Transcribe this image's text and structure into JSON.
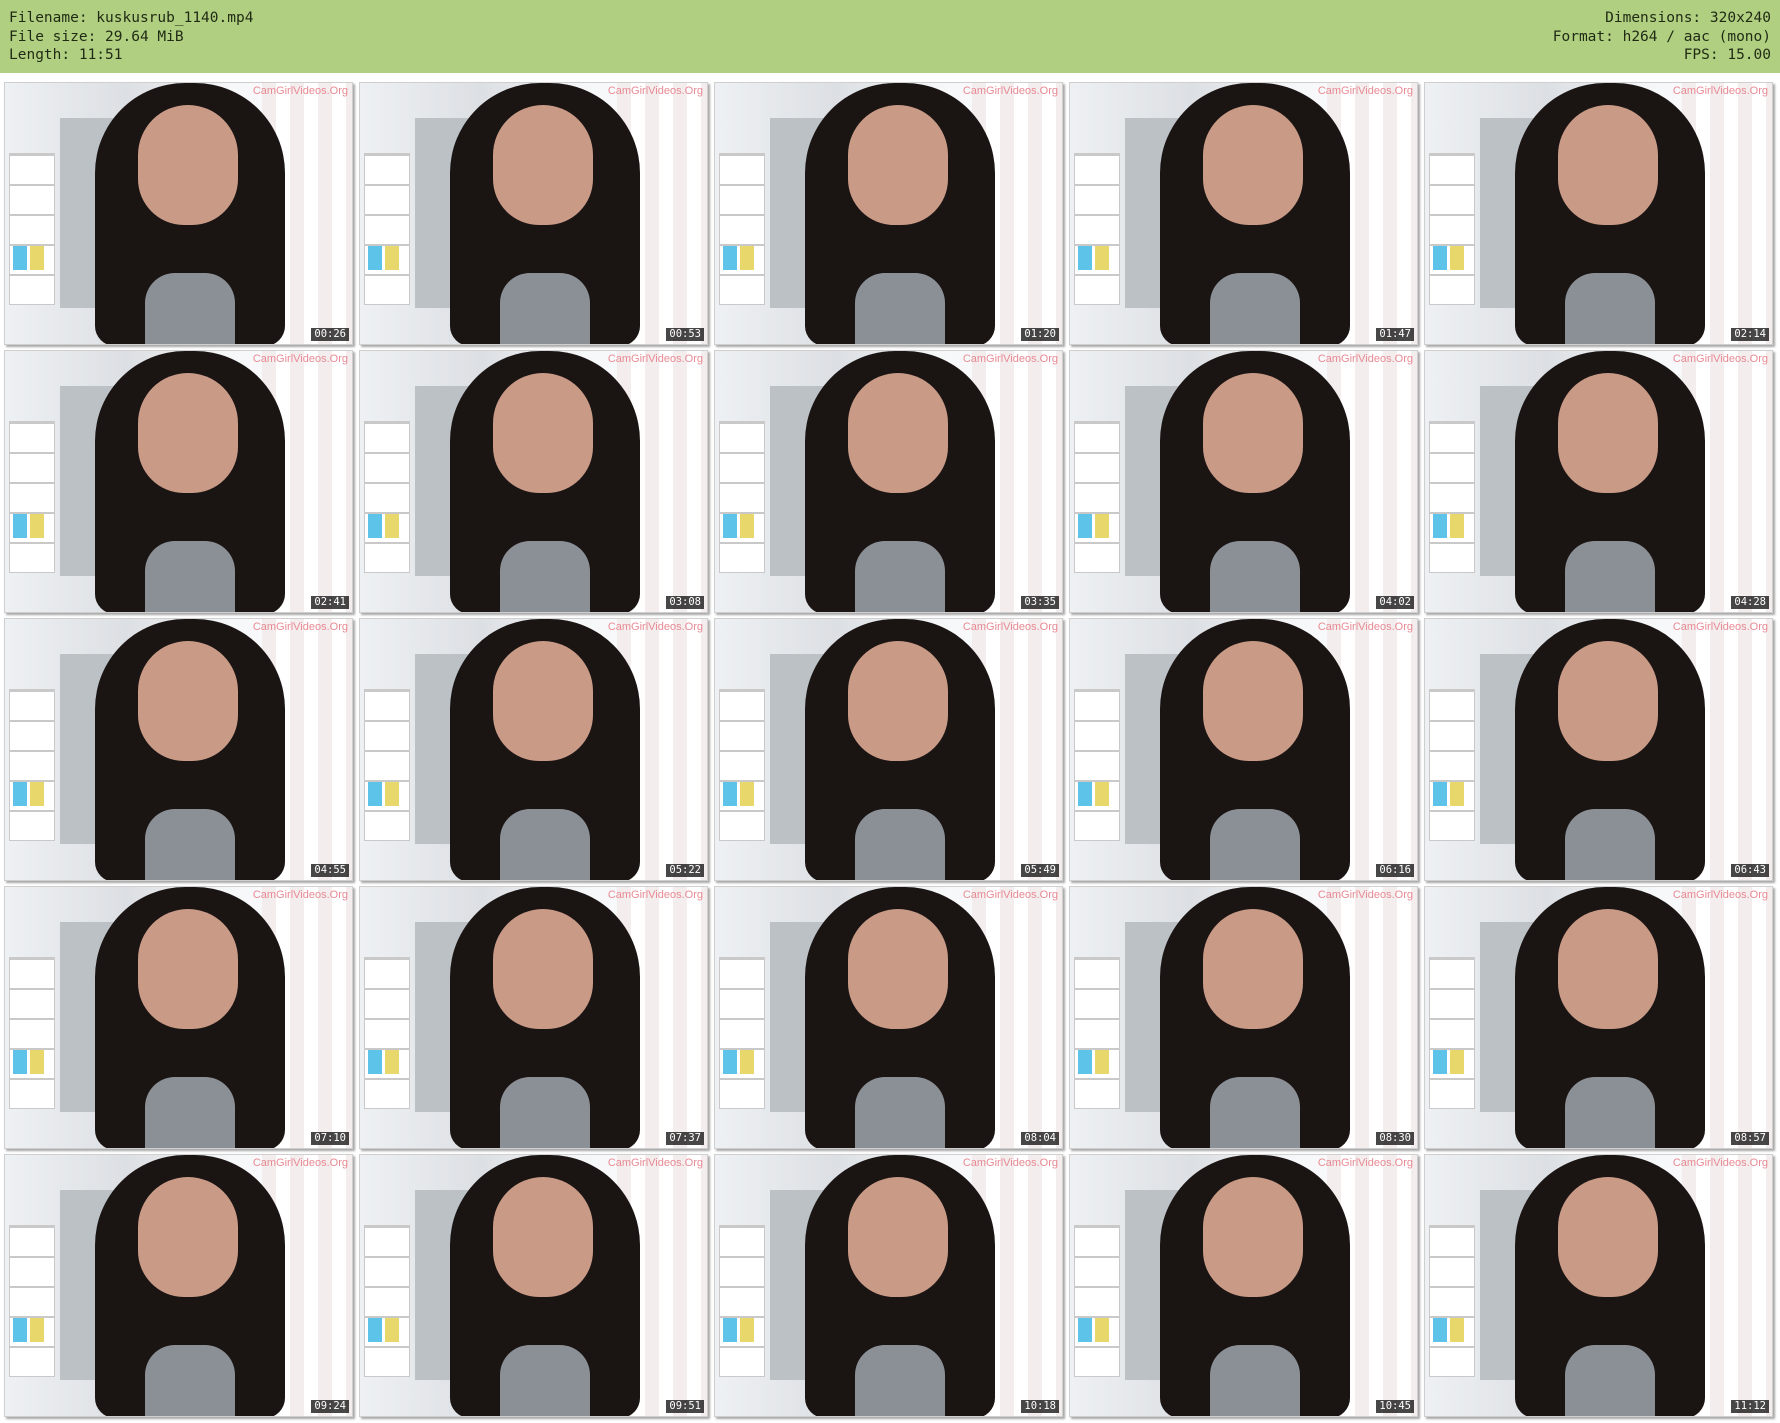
{
  "header": {
    "filename_line": "Filename: kuskusrub_1140.mp4",
    "filesize_line": "File size: 29.64 MiB",
    "length_line": "Length: 11:51",
    "dimensions_line": "Dimensions: 320x240",
    "format_line": "Format: h264 / aac (mono)",
    "fps_line": "FPS: 15.00",
    "background_color": "#b1cf80"
  },
  "thumbnails": [
    {
      "time": "00:26",
      "watermark": "CamGirlVideos.Org"
    },
    {
      "time": "00:53",
      "watermark": "CamGirlVideos.Org"
    },
    {
      "time": "01:20",
      "watermark": "CamGirlVideos.Org"
    },
    {
      "time": "01:47",
      "watermark": "CamGirlVideos.Org"
    },
    {
      "time": "02:14",
      "watermark": "CamGirlVideos.Org"
    },
    {
      "time": "02:41",
      "watermark": "CamGirlVideos.Org"
    },
    {
      "time": "03:08",
      "watermark": "CamGirlVideos.Org"
    },
    {
      "time": "03:35",
      "watermark": "CamGirlVideos.Org"
    },
    {
      "time": "04:02",
      "watermark": "CamGirlVideos.Org"
    },
    {
      "time": "04:28",
      "watermark": "CamGirlVideos.Org"
    },
    {
      "time": "04:55",
      "watermark": "CamGirlVideos.Org"
    },
    {
      "time": "05:22",
      "watermark": "CamGirlVideos.Org"
    },
    {
      "time": "05:49",
      "watermark": "CamGirlVideos.Org"
    },
    {
      "time": "06:16",
      "watermark": "CamGirlVideos.Org"
    },
    {
      "time": "06:43",
      "watermark": "CamGirlVideos.Org"
    },
    {
      "time": "07:10",
      "watermark": "CamGirlVideos.Org"
    },
    {
      "time": "07:37",
      "watermark": "CamGirlVideos.Org"
    },
    {
      "time": "08:04",
      "watermark": "CamGirlVideos.Org"
    },
    {
      "time": "08:30",
      "watermark": "CamGirlVideos.Org"
    },
    {
      "time": "08:57",
      "watermark": "CamGirlVideos.Org"
    },
    {
      "time": "09:24",
      "watermark": "CamGirlVideos.Org"
    },
    {
      "time": "09:51",
      "watermark": "CamGirlVideos.Org"
    },
    {
      "time": "10:18",
      "watermark": "CamGirlVideos.Org"
    },
    {
      "time": "10:45",
      "watermark": "CamGirlVideos.Org"
    },
    {
      "time": "11:12",
      "watermark": "CamGirlVideos.Org"
    }
  ]
}
